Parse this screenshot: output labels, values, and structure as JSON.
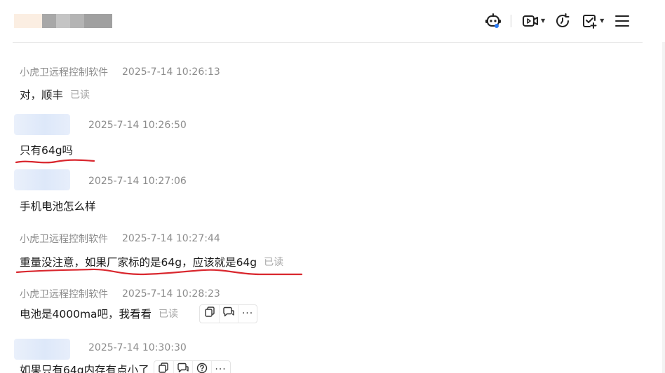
{
  "header": {
    "contact_name_blurred": "",
    "toolbar": {
      "ai_assistant": "robot-icon",
      "video": "video-call-icon",
      "history": "history-icon",
      "task": "task-add-icon",
      "menu": "menu-icon"
    }
  },
  "messages": [
    {
      "sender": "小虎卫远程控制软件",
      "time": "2025-7-14 10:26:13",
      "text": "对，顺丰",
      "read": "已读"
    },
    {
      "sender": "",
      "time": "2025-7-14 10:26:50",
      "text": "只有64g吗",
      "read": ""
    },
    {
      "sender": "",
      "time": "2025-7-14 10:27:06",
      "text": "手机电池怎么样",
      "read": ""
    },
    {
      "sender": "小虎卫远程控制软件",
      "time": "2025-7-14 10:27:44",
      "text": "重量没注意，如果厂家标的是64g，应该就是64g",
      "read": "已读"
    },
    {
      "sender": "小虎卫远程控制软件",
      "time": "2025-7-14 10:28:23",
      "text": "电池是4000ma吧，我看看",
      "read": "已读"
    },
    {
      "sender": "",
      "time": "2025-7-14 10:30:30",
      "text": "如果只有64g内存有点小了",
      "read": ""
    }
  ],
  "colors": {
    "annotation_red": "#d9272e",
    "meta_gray": "#8c8c8c",
    "read_gray": "#a6a6a6"
  }
}
